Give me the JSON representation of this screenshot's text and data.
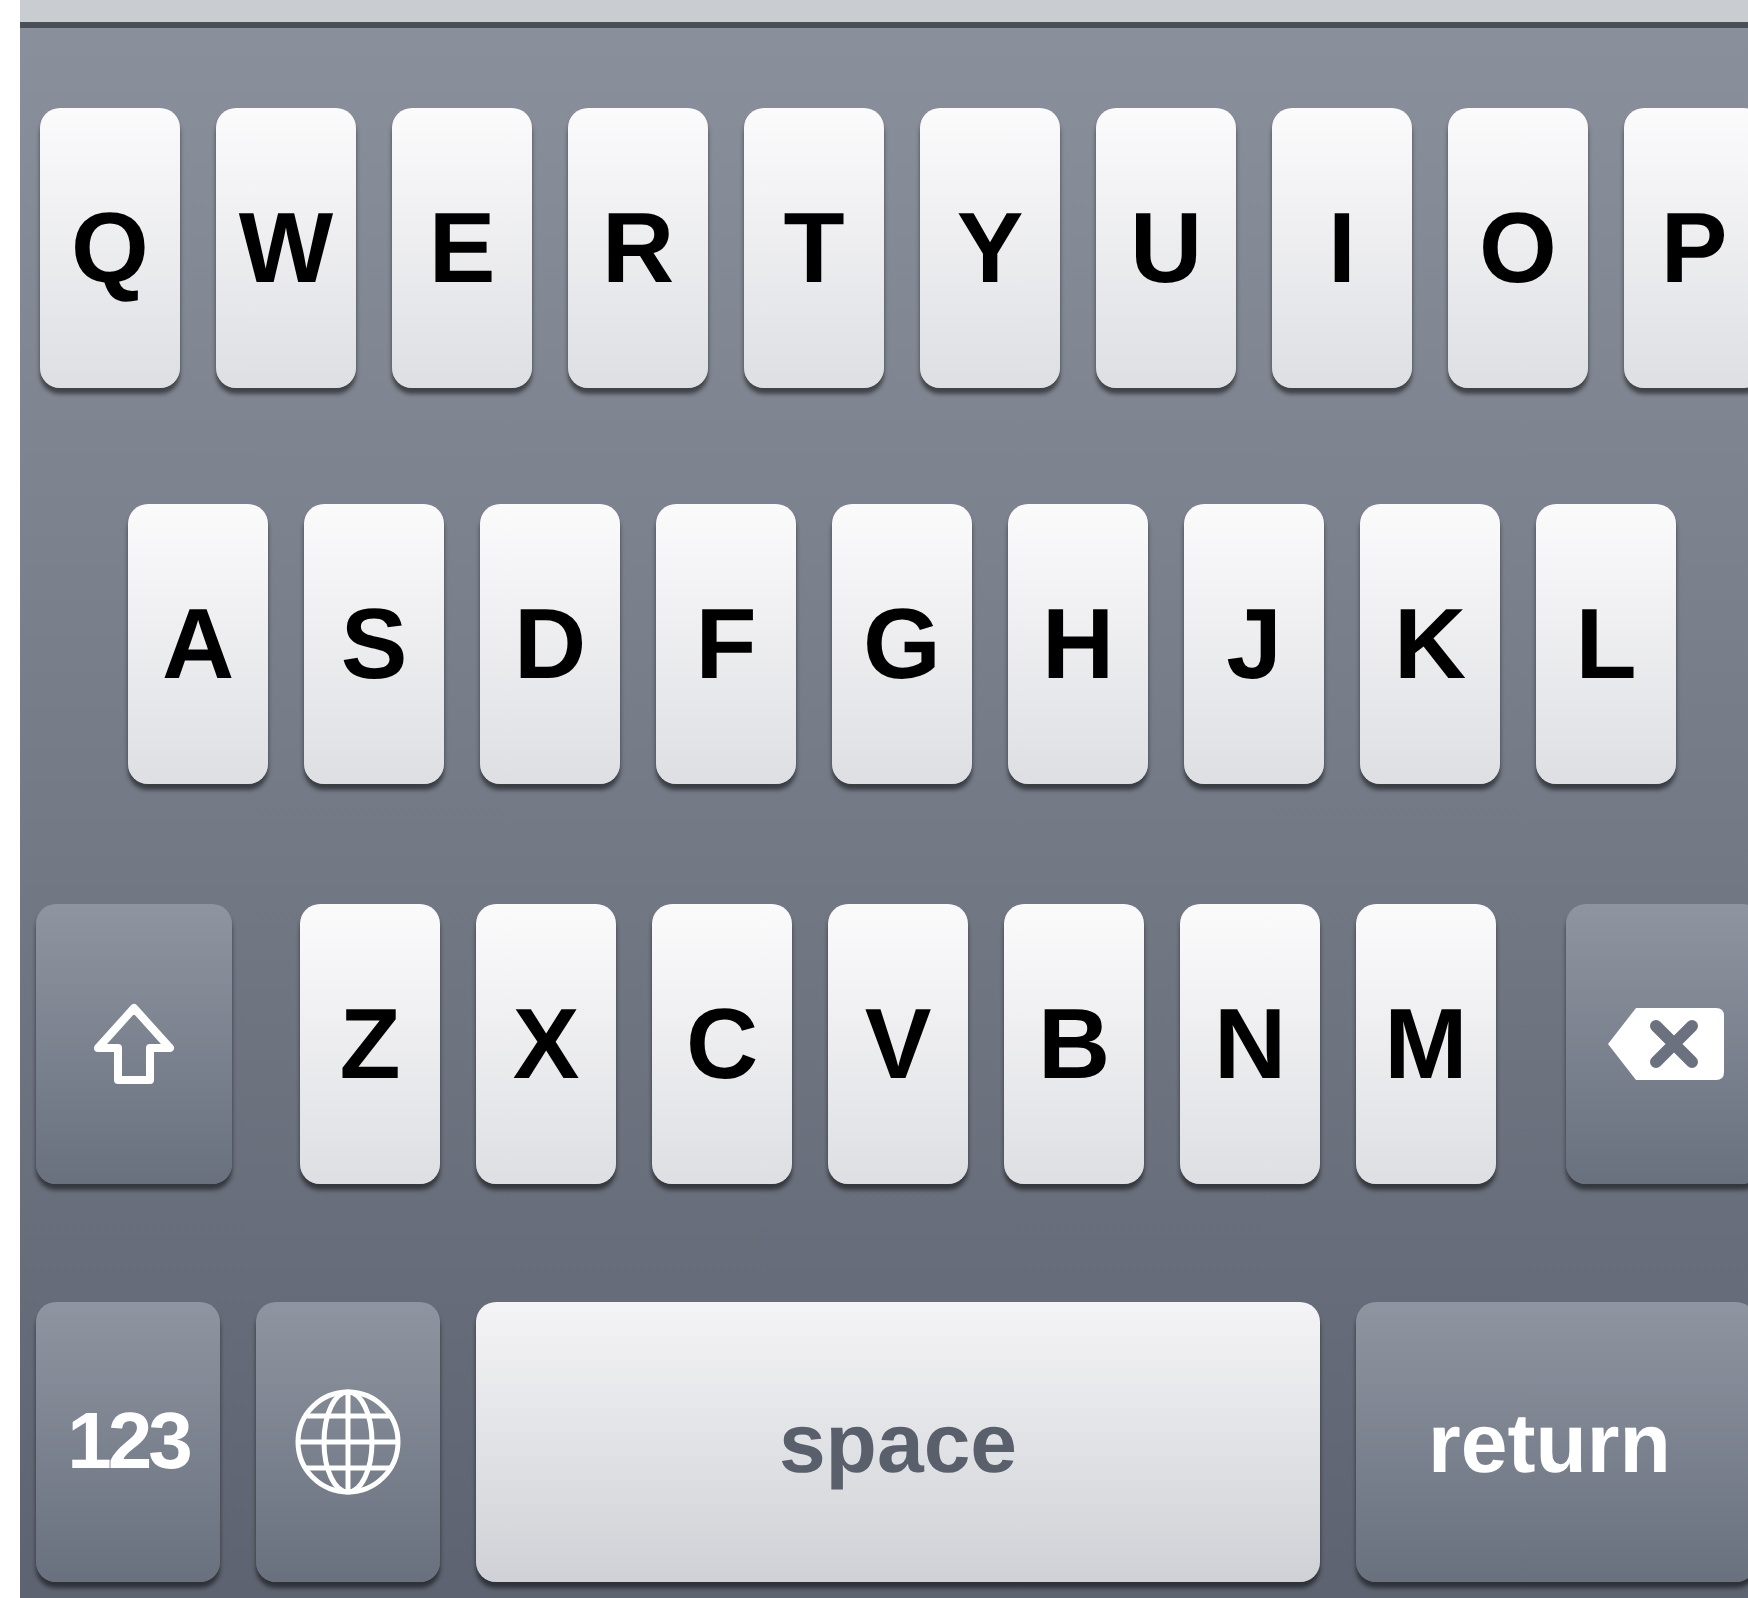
{
  "keyboard": {
    "rows": [
      {
        "keys": [
          {
            "kind": "letter",
            "label": "Q"
          },
          {
            "kind": "letter",
            "label": "W"
          },
          {
            "kind": "letter",
            "label": "E"
          },
          {
            "kind": "letter",
            "label": "R"
          },
          {
            "kind": "letter",
            "label": "T"
          },
          {
            "kind": "letter",
            "label": "Y"
          },
          {
            "kind": "letter",
            "label": "U"
          },
          {
            "kind": "letter",
            "label": "I"
          },
          {
            "kind": "letter",
            "label": "O"
          },
          {
            "kind": "letter",
            "label": "P"
          }
        ]
      },
      {
        "keys": [
          {
            "kind": "letter",
            "label": "A"
          },
          {
            "kind": "letter",
            "label": "S"
          },
          {
            "kind": "letter",
            "label": "D"
          },
          {
            "kind": "letter",
            "label": "F"
          },
          {
            "kind": "letter",
            "label": "G"
          },
          {
            "kind": "letter",
            "label": "H"
          },
          {
            "kind": "letter",
            "label": "J"
          },
          {
            "kind": "letter",
            "label": "K"
          },
          {
            "kind": "letter",
            "label": "L"
          }
        ]
      },
      {
        "keys": [
          {
            "kind": "shift"
          },
          {
            "kind": "letter",
            "label": "Z"
          },
          {
            "kind": "letter",
            "label": "X"
          },
          {
            "kind": "letter",
            "label": "C"
          },
          {
            "kind": "letter",
            "label": "V"
          },
          {
            "kind": "letter",
            "label": "B"
          },
          {
            "kind": "letter",
            "label": "N"
          },
          {
            "kind": "letter",
            "label": "M"
          },
          {
            "kind": "delete"
          }
        ]
      },
      {
        "keys": [
          {
            "kind": "numbers",
            "label": "123"
          },
          {
            "kind": "globe"
          },
          {
            "kind": "space",
            "label": "space"
          },
          {
            "kind": "return",
            "label": "return"
          }
        ]
      }
    ]
  }
}
